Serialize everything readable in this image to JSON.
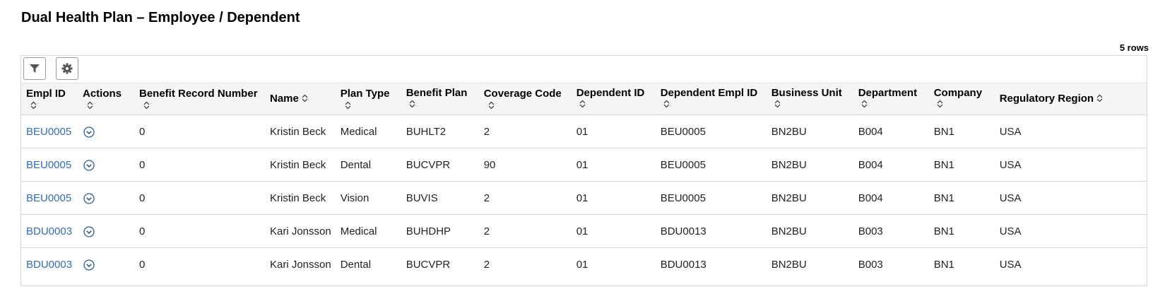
{
  "page": {
    "title": "Dual Health Plan – Employee / Dependent",
    "row_count": "5 rows"
  },
  "toolbar": {
    "filter_icon": "filter-icon",
    "settings_icon": "gear-icon"
  },
  "columns": [
    "Empl ID",
    "Actions",
    "Benefit Record Number",
    "Name",
    "Plan Type",
    "Benefit Plan",
    "Coverage Code",
    "Dependent ID",
    "Dependent Empl ID",
    "Business Unit",
    "Department",
    "Company",
    "Regulatory Region"
  ],
  "rows": [
    {
      "empl_id": "BEU0005",
      "benefit_record": "0",
      "name": "Kristin Beck",
      "plan_type": "Medical",
      "benefit_plan": "BUHLT2",
      "coverage_code": "2",
      "dependent_id": "01",
      "dependent_empl_id": "BEU0005",
      "business_unit": "BN2BU",
      "department": "B004",
      "company": "BN1",
      "regulatory_region": "USA"
    },
    {
      "empl_id": "BEU0005",
      "benefit_record": "0",
      "name": "Kristin Beck",
      "plan_type": "Dental",
      "benefit_plan": "BUCVPR",
      "coverage_code": "90",
      "dependent_id": "01",
      "dependent_empl_id": "BEU0005",
      "business_unit": "BN2BU",
      "department": "B004",
      "company": "BN1",
      "regulatory_region": "USA"
    },
    {
      "empl_id": "BEU0005",
      "benefit_record": "0",
      "name": "Kristin Beck",
      "plan_type": "Vision",
      "benefit_plan": "BUVIS",
      "coverage_code": "2",
      "dependent_id": "01",
      "dependent_empl_id": "BEU0005",
      "business_unit": "BN2BU",
      "department": "B004",
      "company": "BN1",
      "regulatory_region": "USA"
    },
    {
      "empl_id": "BDU0003",
      "benefit_record": "0",
      "name": "Kari Jonsson",
      "plan_type": "Medical",
      "benefit_plan": "BUHDHP",
      "coverage_code": "2",
      "dependent_id": "01",
      "dependent_empl_id": "BDU0013",
      "business_unit": "BN2BU",
      "department": "B003",
      "company": "BN1",
      "regulatory_region": "USA"
    },
    {
      "empl_id": "BDU0003",
      "benefit_record": "0",
      "name": "Kari Jonsson",
      "plan_type": "Dental",
      "benefit_plan": "BUCVPR",
      "coverage_code": "2",
      "dependent_id": "01",
      "dependent_empl_id": "BDU0013",
      "business_unit": "BN2BU",
      "department": "B003",
      "company": "BN1",
      "regulatory_region": "USA"
    }
  ],
  "colors": {
    "link": "#2f6db5",
    "header_bg": "#f5f5f5",
    "border": "#d6d6d6"
  }
}
